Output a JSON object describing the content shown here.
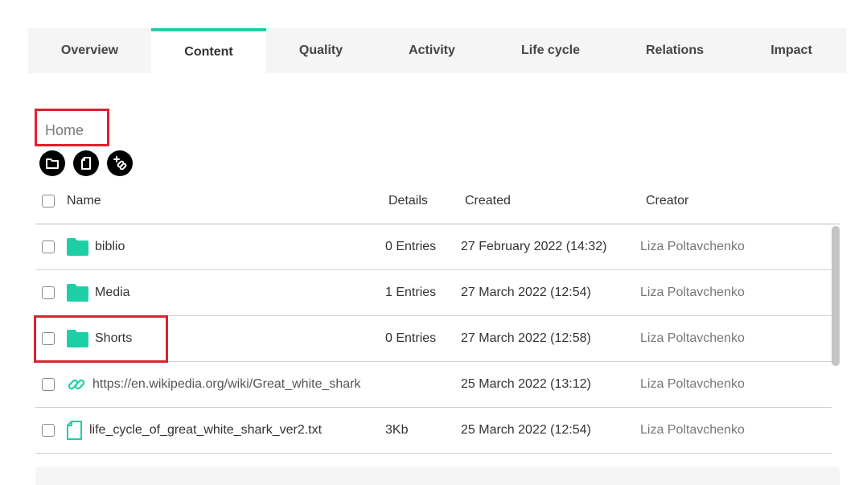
{
  "tabs": [
    {
      "label": "Overview",
      "width": 153
    },
    {
      "label": "Content",
      "width": 143,
      "active": true
    },
    {
      "label": "Quality",
      "width": 136
    },
    {
      "label": "Activity",
      "width": 140
    },
    {
      "label": "Life cycle",
      "width": 155
    },
    {
      "label": "Relations",
      "width": 154
    },
    {
      "label": "Impact",
      "width": 136
    }
  ],
  "breadcrumb": "Home",
  "toolbar": {
    "new_folder_icon": "folder-icon",
    "new_file_icon": "file-icon",
    "add_link_icon": "add-link-icon"
  },
  "table": {
    "headers": {
      "name": "Name",
      "details": "Details",
      "created": "Created",
      "creator": "Creator"
    },
    "rows": [
      {
        "type": "folder",
        "name": "biblio",
        "details": "0 Entries",
        "created": "27 February 2022 (14:32)",
        "creator": "Liza Poltavchenko"
      },
      {
        "type": "folder",
        "name": "Media",
        "details": "1 Entries",
        "created": "27 March 2022 (12:54)",
        "creator": "Liza Poltavchenko"
      },
      {
        "type": "folder",
        "name": "Shorts",
        "details": "0 Entries",
        "created": "27 March 2022 (12:58)",
        "creator": "Liza Poltavchenko"
      },
      {
        "type": "link",
        "name": "https://en.wikipedia.org/wiki/Great_white_shark",
        "details": "",
        "created": "25 March 2022 (13:12)",
        "creator": "Liza Poltavchenko"
      },
      {
        "type": "file",
        "name": "life_cycle_of_great_white_shark_ver2.txt",
        "details": "3Kb",
        "created": "25 March 2022 (12:54)",
        "creator": "Liza Poltavchenko"
      }
    ]
  },
  "colors": {
    "accent": "#1ecfa5",
    "highlight": "#e0202e"
  }
}
